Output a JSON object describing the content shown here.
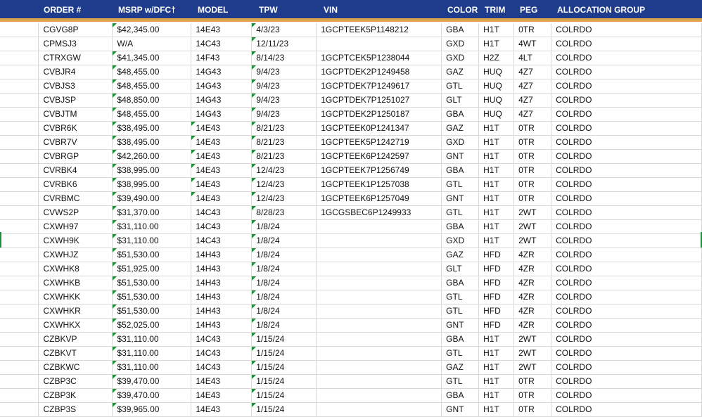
{
  "headers": {
    "order": "ORDER #",
    "msrp": "MSRP w/DFC†",
    "model": "MODEL",
    "tpw": "TPW",
    "vin": "VIN",
    "color": "COLOR",
    "trim": "TRIM",
    "peg": "PEG",
    "allocation": "ALLOCATION GROUP"
  },
  "rows": [
    {
      "order": "CGVG8P",
      "msrp": "$42,345.00",
      "model": "14E43",
      "tpw": "4/3/23",
      "vin": "1GCPTEEK5P1148212",
      "color": "GBA",
      "trim": "H1T",
      "peg": "0TR",
      "alloc": "COLRDO"
    },
    {
      "order": "CPMSJ3",
      "msrp": "W/A",
      "model": "14C43",
      "tpw": "12/11/23",
      "vin": "",
      "color": "GXD",
      "trim": "H1T",
      "peg": "4WT",
      "alloc": "COLRDO"
    },
    {
      "order": "CTRXGW",
      "msrp": "$41,345.00",
      "model": "14F43",
      "tpw": "8/14/23",
      "vin": "1GCPTCEK5P1238044",
      "color": "GXD",
      "trim": "H2Z",
      "peg": "4LT",
      "alloc": "COLRDO"
    },
    {
      "order": "CVBJR4",
      "msrp": "$48,455.00",
      "model": "14G43",
      "tpw": "9/4/23",
      "vin": "1GCPTDEK2P1249458",
      "color": "GAZ",
      "trim": "HUQ",
      "peg": "4Z7",
      "alloc": "COLRDO"
    },
    {
      "order": "CVBJS3",
      "msrp": "$48,455.00",
      "model": "14G43",
      "tpw": "9/4/23",
      "vin": "1GCPTDEK7P1249617",
      "color": "GTL",
      "trim": "HUQ",
      "peg": "4Z7",
      "alloc": "COLRDO"
    },
    {
      "order": "CVBJSP",
      "msrp": "$48,850.00",
      "model": "14G43",
      "tpw": "9/4/23",
      "vin": "1GCPTDEK7P1251027",
      "color": "GLT",
      "trim": "HUQ",
      "peg": "4Z7",
      "alloc": "COLRDO"
    },
    {
      "order": "CVBJTM",
      "msrp": "$48,455.00",
      "model": "14G43",
      "tpw": "9/4/23",
      "vin": "1GCPTDEK2P1250187",
      "color": "GBA",
      "trim": "HUQ",
      "peg": "4Z7",
      "alloc": "COLRDO"
    },
    {
      "order": "CVBR6K",
      "msrp": "$38,495.00",
      "model": "14E43",
      "tpw": "8/21/23",
      "vin": "1GCPTEEK0P1241347",
      "color": "GAZ",
      "trim": "H1T",
      "peg": "0TR",
      "alloc": "COLRDO"
    },
    {
      "order": "CVBR7V",
      "msrp": "$38,495.00",
      "model": "14E43",
      "tpw": "8/21/23",
      "vin": "1GCPTEEK5P1242719",
      "color": "GXD",
      "trim": "H1T",
      "peg": "0TR",
      "alloc": "COLRDO"
    },
    {
      "order": "CVBRGP",
      "msrp": "$42,260.00",
      "model": "14E43",
      "tpw": "8/21/23",
      "vin": "1GCPTEEK6P1242597",
      "color": "GNT",
      "trim": "H1T",
      "peg": "0TR",
      "alloc": "COLRDO"
    },
    {
      "order": "CVRBK4",
      "msrp": "$38,995.00",
      "model": "14E43",
      "tpw": "12/4/23",
      "vin": "1GCPTEEK7P1256749",
      "color": "GBA",
      "trim": "H1T",
      "peg": "0TR",
      "alloc": "COLRDO"
    },
    {
      "order": "CVRBK6",
      "msrp": "$38,995.00",
      "model": "14E43",
      "tpw": "12/4/23",
      "vin": "1GCPTEEK1P1257038",
      "color": "GTL",
      "trim": "H1T",
      "peg": "0TR",
      "alloc": "COLRDO"
    },
    {
      "order": "CVRBMC",
      "msrp": "$39,490.00",
      "model": "14E43",
      "tpw": "12/4/23",
      "vin": "1GCPTEEK6P1257049",
      "color": "GNT",
      "trim": "H1T",
      "peg": "0TR",
      "alloc": "COLRDO"
    },
    {
      "order": "CVWS2P",
      "msrp": "$31,370.00",
      "model": "14C43",
      "tpw": "8/28/23",
      "vin": "1GCGSBEC6P1249933",
      "color": "GTL",
      "trim": "H1T",
      "peg": "2WT",
      "alloc": "COLRDO"
    },
    {
      "order": "CXWH97",
      "msrp": "$31,110.00",
      "model": "14C43",
      "tpw": "1/8/24",
      "vin": "",
      "color": "GBA",
      "trim": "H1T",
      "peg": "2WT",
      "alloc": "COLRDO"
    },
    {
      "order": "CXWH9K",
      "msrp": "$31,110.00",
      "model": "14C43",
      "tpw": "1/8/24",
      "vin": "",
      "color": "GXD",
      "trim": "H1T",
      "peg": "2WT",
      "alloc": "COLRDO"
    },
    {
      "order": "CXWHJZ",
      "msrp": "$51,530.00",
      "model": "14H43",
      "tpw": "1/8/24",
      "vin": "",
      "color": "GAZ",
      "trim": "HFD",
      "peg": "4ZR",
      "alloc": "COLRDO"
    },
    {
      "order": "CXWHK8",
      "msrp": "$51,925.00",
      "model": "14H43",
      "tpw": "1/8/24",
      "vin": "",
      "color": "GLT",
      "trim": "HFD",
      "peg": "4ZR",
      "alloc": "COLRDO"
    },
    {
      "order": "CXWHKB",
      "msrp": "$51,530.00",
      "model": "14H43",
      "tpw": "1/8/24",
      "vin": "",
      "color": "GBA",
      "trim": "HFD",
      "peg": "4ZR",
      "alloc": "COLRDO"
    },
    {
      "order": "CXWHKK",
      "msrp": "$51,530.00",
      "model": "14H43",
      "tpw": "1/8/24",
      "vin": "",
      "color": "GTL",
      "trim": "HFD",
      "peg": "4ZR",
      "alloc": "COLRDO"
    },
    {
      "order": "CXWHKR",
      "msrp": "$51,530.00",
      "model": "14H43",
      "tpw": "1/8/24",
      "vin": "",
      "color": "GTL",
      "trim": "HFD",
      "peg": "4ZR",
      "alloc": "COLRDO"
    },
    {
      "order": "CXWHKX",
      "msrp": "$52,025.00",
      "model": "14H43",
      "tpw": "1/8/24",
      "vin": "",
      "color": "GNT",
      "trim": "HFD",
      "peg": "4ZR",
      "alloc": "COLRDO"
    },
    {
      "order": "CZBKVP",
      "msrp": "$31,110.00",
      "model": "14C43",
      "tpw": "1/15/24",
      "vin": "",
      "color": "GBA",
      "trim": "H1T",
      "peg": "2WT",
      "alloc": "COLRDO"
    },
    {
      "order": "CZBKVT",
      "msrp": "$31,110.00",
      "model": "14C43",
      "tpw": "1/15/24",
      "vin": "",
      "color": "GTL",
      "trim": "H1T",
      "peg": "2WT",
      "alloc": "COLRDO"
    },
    {
      "order": "CZBKWC",
      "msrp": "$31,110.00",
      "model": "14C43",
      "tpw": "1/15/24",
      "vin": "",
      "color": "GAZ",
      "trim": "H1T",
      "peg": "2WT",
      "alloc": "COLRDO"
    },
    {
      "order": "CZBP3C",
      "msrp": "$39,470.00",
      "model": "14E43",
      "tpw": "1/15/24",
      "vin": "",
      "color": "GTL",
      "trim": "H1T",
      "peg": "0TR",
      "alloc": "COLRDO"
    },
    {
      "order": "CZBP3K",
      "msrp": "$39,470.00",
      "model": "14E43",
      "tpw": "1/15/24",
      "vin": "",
      "color": "GBA",
      "trim": "H1T",
      "peg": "0TR",
      "alloc": "COLRDO"
    },
    {
      "order": "CZBP3S",
      "msrp": "$39,965.00",
      "model": "14E43",
      "tpw": "1/15/24",
      "vin": "",
      "color": "GNT",
      "trim": "H1T",
      "peg": "0TR",
      "alloc": "COLRDO"
    }
  ],
  "colors": {
    "header_bg": "#1f3c8c",
    "header_text": "#ffffff",
    "accent_strip": "#e0a64b",
    "indicator_green": "#1d8f3a"
  },
  "indicator_icon": "green-corner-triangle"
}
